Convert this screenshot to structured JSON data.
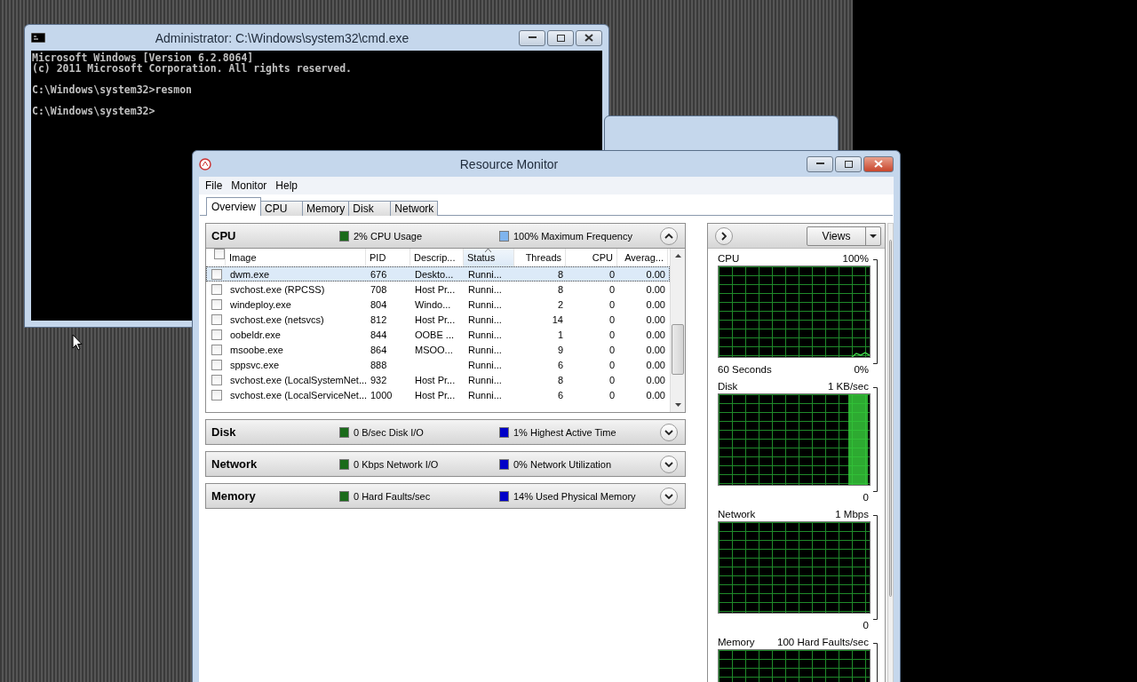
{
  "console_window": {
    "title": "Administrator: C:\\Windows\\system32\\cmd.exe",
    "lines": [
      {
        "text": "Microsoft Windows [Version 6.2.8064]",
        "gap_before": false
      },
      {
        "text": "(c) 2011 Microsoft Corporation. All rights reserved.",
        "gap_before": false
      },
      {
        "text": "C:\\Windows\\system32>resmon",
        "gap_before": true
      },
      {
        "text": "C:\\Windows\\system32>",
        "gap_before": true
      }
    ]
  },
  "resource_monitor": {
    "title": "Resource Monitor",
    "menu": [
      "File",
      "Monitor",
      "Help"
    ],
    "tabs": [
      {
        "label": "Overview",
        "selected": true
      },
      {
        "label": "CPU",
        "selected": false
      },
      {
        "label": "Memory",
        "selected": false
      },
      {
        "label": "Disk",
        "selected": false
      },
      {
        "label": "Network",
        "selected": false
      }
    ],
    "sections": [
      {
        "title": "CPU",
        "expanded": true,
        "legend": [
          {
            "text": "2% CPU Usage",
            "color": "#1a6b1a"
          },
          {
            "text": "100% Maximum Frequency",
            "color": "#7fb4ee"
          }
        ],
        "table": {
          "all_checked": false,
          "columns": [
            {
              "label": "Image",
              "sorted": false
            },
            {
              "label": "PID",
              "sorted": false
            },
            {
              "label": "Descrip...",
              "sorted": false
            },
            {
              "label": "Status",
              "sorted": true
            },
            {
              "label": "Threads",
              "sorted": false
            },
            {
              "label": "CPU",
              "sorted": false
            },
            {
              "label": "Averag...",
              "sorted": false
            }
          ],
          "rows": [
            {
              "image": "dwm.exe",
              "pid": "676",
              "description": "Deskto...",
              "status": "Runni...",
              "threads": "8",
              "cpu": "0",
              "average": "0.00",
              "selected": true,
              "checked": false
            },
            {
              "image": "svchost.exe (RPCSS)",
              "pid": "708",
              "description": "Host Pr...",
              "status": "Runni...",
              "threads": "8",
              "cpu": "0",
              "average": "0.00",
              "selected": false,
              "checked": false
            },
            {
              "image": "windeploy.exe",
              "pid": "804",
              "description": "Windo...",
              "status": "Runni...",
              "threads": "2",
              "cpu": "0",
              "average": "0.00",
              "selected": false,
              "checked": false
            },
            {
              "image": "svchost.exe (netsvcs)",
              "pid": "812",
              "description": "Host Pr...",
              "status": "Runni...",
              "threads": "14",
              "cpu": "0",
              "average": "0.00",
              "selected": false,
              "checked": false
            },
            {
              "image": "oobeldr.exe",
              "pid": "844",
              "description": "OOBE ...",
              "status": "Runni...",
              "threads": "1",
              "cpu": "0",
              "average": "0.00",
              "selected": false,
              "checked": false
            },
            {
              "image": "msoobe.exe",
              "pid": "864",
              "description": "MSOO...",
              "status": "Runni...",
              "threads": "9",
              "cpu": "0",
              "average": "0.00",
              "selected": false,
              "checked": false
            },
            {
              "image": "sppsvc.exe",
              "pid": "888",
              "status": "Runni...",
              "threads": "6",
              "cpu": "0",
              "average": "0.00",
              "selected": false,
              "checked": false
            },
            {
              "image": "svchost.exe (LocalSystemNet...",
              "pid": "932",
              "description": "Host Pr...",
              "status": "Runni...",
              "threads": "8",
              "cpu": "0",
              "average": "0.00",
              "selected": false,
              "checked": false
            },
            {
              "image": "svchost.exe (LocalServiceNet...",
              "pid": "1000",
              "description": "Host Pr...",
              "status": "Runni...",
              "threads": "6",
              "cpu": "0",
              "average": "0.00",
              "selected": false,
              "checked": false
            }
          ]
        }
      },
      {
        "title": "Disk",
        "expanded": false,
        "legend": [
          {
            "text": "0 B/sec Disk I/O",
            "color": "#1a6b1a"
          },
          {
            "text": "1% Highest Active Time",
            "color": "#0000c8"
          }
        ]
      },
      {
        "title": "Network",
        "expanded": false,
        "legend": [
          {
            "text": "0 Kbps Network I/O",
            "color": "#1a6b1a"
          },
          {
            "text": "0% Network Utilization",
            "color": "#0000c8"
          }
        ]
      },
      {
        "title": "Memory",
        "expanded": false,
        "legend": [
          {
            "text": "0 Hard Faults/sec",
            "color": "#1a6b1a"
          },
          {
            "text": "14% Used Physical Memory",
            "color": "#0000c8"
          }
        ]
      }
    ],
    "graph_panel": {
      "views_button": "Views",
      "graphs": [
        {
          "kind": "cpu",
          "title": "CPU",
          "top_label": "100%",
          "bottom_left": "60 Seconds",
          "bottom_label": "0%"
        },
        {
          "kind": "disk",
          "title": "Disk",
          "top_label": "1 KB/sec",
          "bottom_label": "0"
        },
        {
          "kind": "network",
          "title": "Network",
          "top_label": "1 Mbps",
          "bottom_label": "0"
        },
        {
          "kind": "memory",
          "title": "Memory",
          "top_label": "100 Hard Faults/sec"
        }
      ]
    }
  }
}
